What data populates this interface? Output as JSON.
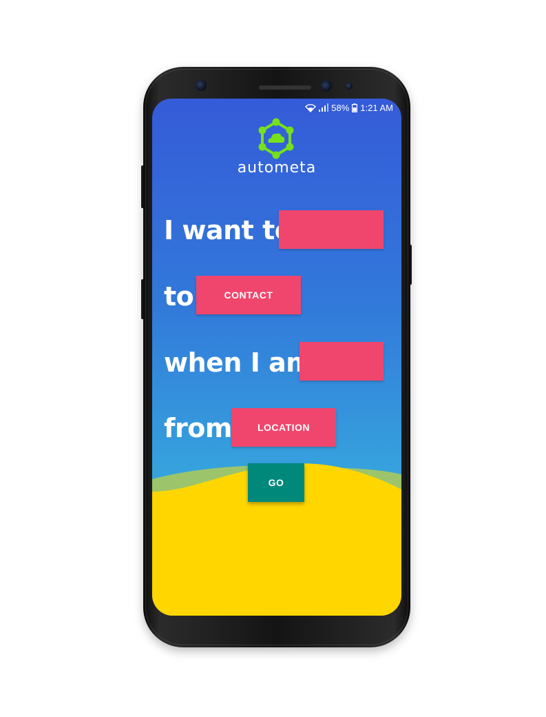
{
  "status_bar": {
    "battery": "58%",
    "time": "1:21 AM",
    "icons": [
      "wifi-icon",
      "signal-icon",
      "battery-icon"
    ]
  },
  "brand": {
    "name": "autometa",
    "logo_icon": "cloud-network-icon"
  },
  "sentence": {
    "line1": "I want to",
    "line2": "to",
    "line3": "when I am",
    "line4": "from",
    "action_value": "",
    "contact_label": "CONTACT",
    "condition_value": "",
    "location_label": "LOCATION"
  },
  "go_label": "GO",
  "colors": {
    "background_top": "#355bd8",
    "background_bottom": "#37ade0",
    "pill": "#f0466e",
    "go_button": "#00897b",
    "hill_green": "#9cc56b",
    "ground_yellow": "#ffd600",
    "logo_green": "#76e01c"
  }
}
